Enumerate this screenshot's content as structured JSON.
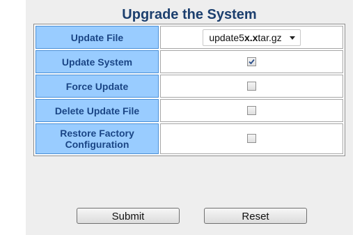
{
  "page": {
    "title": "Upgrade the System"
  },
  "form": {
    "rows": [
      {
        "label": "Update File"
      },
      {
        "label": "Update System",
        "checked": true
      },
      {
        "label": "Force Update",
        "checked": false
      },
      {
        "label": "Delete Update File",
        "checked": false
      },
      {
        "label_line1": "Restore Factory",
        "label_line2": "Configuration",
        "checked": false
      }
    ],
    "update_file": {
      "prefix": "update5",
      "bold_part": "x.x",
      "suffix": "tar.gz"
    }
  },
  "buttons": {
    "submit_label": "Submit",
    "reset_label": "Reset"
  },
  "colors": {
    "title": "#1c3f6e",
    "label_bg": "#99ccff",
    "label_text": "#1a4585",
    "panel_bg": "#eeeeee"
  }
}
